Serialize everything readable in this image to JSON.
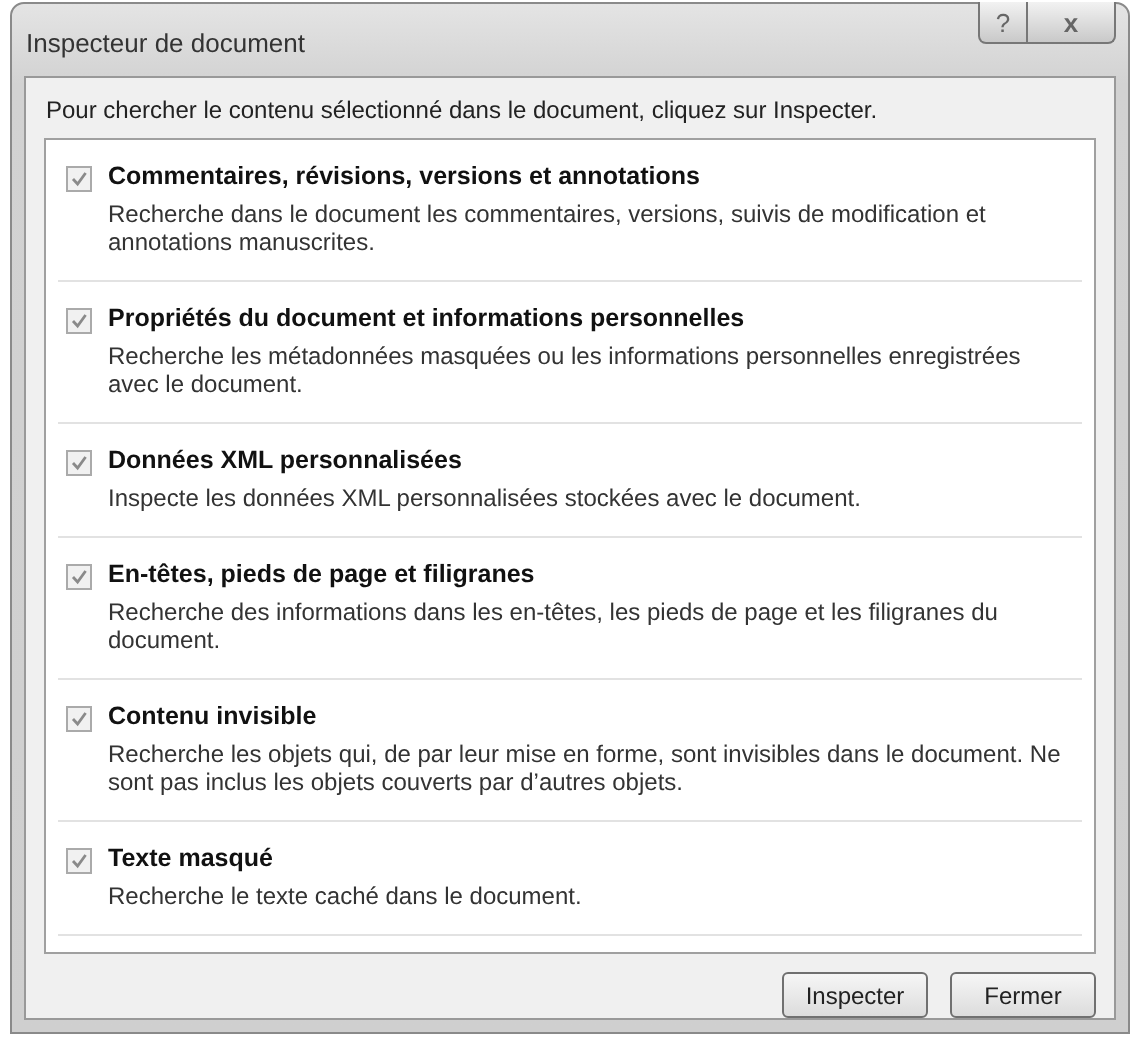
{
  "window": {
    "title": "Inspecteur de document",
    "help_button": "?",
    "close_button": "x"
  },
  "instruction": "Pour chercher le contenu sélectionné dans le document, cliquez sur Inspecter.",
  "options": [
    {
      "label": "Commentaires, révisions, versions et annotations",
      "description": "Recherche dans le document les commentaires, versions, suivis de modification et annotations manuscrites.",
      "checked": true
    },
    {
      "label": "Propriétés du document et informations personnelles",
      "description": "Recherche les métadonnées masquées ou les informations personnelles enregistrées avec le document.",
      "checked": true
    },
    {
      "label": "Données XML personnalisées",
      "description": "Inspecte les données XML personnalisées stockées avec le document.",
      "checked": true
    },
    {
      "label": "En-têtes, pieds de page et filigranes",
      "description": "Recherche des informations dans les en-têtes, les pieds de page et les filigranes du document.",
      "checked": true
    },
    {
      "label": "Contenu invisible",
      "description": "Recherche les objets qui, de par leur mise en forme, sont invisibles dans le document. Ne sont pas inclus les objets couverts par d’autres objets.",
      "checked": true
    },
    {
      "label": "Texte masqué",
      "description": "Recherche le texte caché dans le document.",
      "checked": true
    }
  ],
  "buttons": [
    "Inspecter",
    "Fermer"
  ]
}
